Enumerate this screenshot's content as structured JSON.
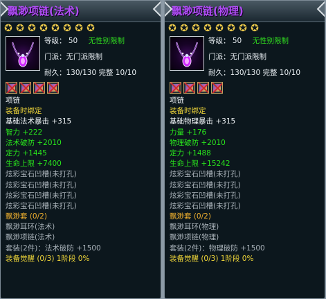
{
  "panels": [
    {
      "title": "飘渺项链(法术)",
      "stars": 8,
      "level_label": "等级：",
      "level": "50",
      "gender_limit": "无性别限制",
      "sect_limit": "门派：无门派限制",
      "durability": "耐久：130/130 完整 10/10",
      "type": "项链",
      "bind": "装备时绑定",
      "base_stat": "基础法术暴击 +315",
      "stats": [
        "智力 +222",
        "法术破防 +2010",
        "定力 +1445",
        "生命上限 +7400"
      ],
      "gem_slots": [
        "炫彩宝石凹槽(未打孔)",
        "炫彩宝石凹槽(未打孔)",
        "炫彩宝石凹槽(未打孔)",
        "炫彩宝石凹槽(未打孔)"
      ],
      "set_name": "飘渺套 (0/2)",
      "set_items": [
        "飘渺耳环(法术)",
        "飘渺项链(法术)"
      ],
      "set_bonus": "套装(2件)：法术破防 +1500",
      "awaken": "装备觉醒 (0/3) 1阶段 0%"
    },
    {
      "title": "飘渺项链(物理)",
      "stars": 8,
      "level_label": "等级：",
      "level": "50",
      "gender_limit": "无性别限制",
      "sect_limit": "门派：无门派限制",
      "durability": "耐久：130/130 完整 10/10",
      "type": "项链",
      "bind": "装备时绑定",
      "base_stat": "基础物理暴击 +315",
      "stats": [
        "力量 +176",
        "物理破防 +2010",
        "定力 +1488",
        "生命上限 +15242"
      ],
      "gem_slots": [
        "炫彩宝石凹槽(未打孔)",
        "炫彩宝石凹槽(未打孔)",
        "炫彩宝石凹槽(未打孔)",
        "炫彩宝石凹槽(未打孔)"
      ],
      "set_name": "飘渺套 (0/2)",
      "set_items": [
        "飘渺耳环(物理)",
        "飘渺项链(物理)"
      ],
      "set_bonus": "套装(2件)：物理破防 +1500",
      "awaken": "装备觉醒 (0/3) 1阶段 0%"
    }
  ],
  "colors": {
    "title": "#b04df6",
    "stat": "#29e41c",
    "label_yellow": "#f2d83a",
    "set_orange": "#f0b02e",
    "empty_gray": "#a7b0b7"
  },
  "icons": {
    "star": "star-icon",
    "item": "necklace-icon",
    "socket": "empty-socket-icon"
  }
}
